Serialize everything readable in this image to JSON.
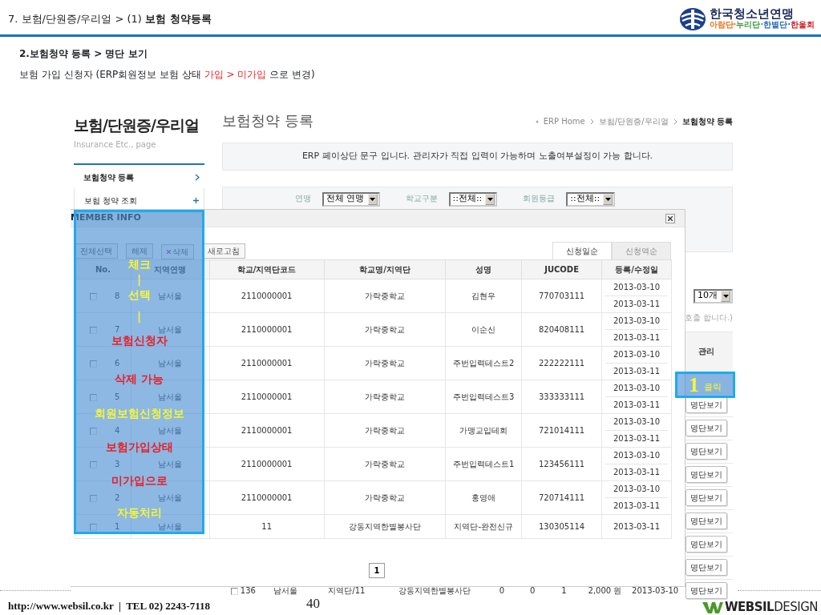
{
  "slide": {
    "title": "7. 보험/단원증/우리얼 > (1) ",
    "title_bold": "보험 청약등록",
    "logo": {
      "name": "한국청소년연맹",
      "parts": [
        {
          "text": "아람단·",
          "color": "#e8731c"
        },
        {
          "text": "누리단·",
          "color": "#3a9a3a"
        },
        {
          "text": "한별단·",
          "color": "#2a6fb8"
        },
        {
          "text": "한울회",
          "color": "#d0202a"
        }
      ]
    },
    "heading": "2.보험청약 등록 > 명단 보기",
    "description": [
      {
        "text": "보험 가입 신청자 (ERP회원정보 보험 상태 ",
        "highlight": false
      },
      {
        "text": "가입 > 미가입",
        "highlight": true
      },
      {
        "text": " 으로 변경)",
        "highlight": false
      }
    ]
  },
  "page": {
    "section_title": "보험/단원증/우리얼",
    "section_subtitle": "Insurance Etc., page",
    "menu": [
      {
        "label": "보험청약 등록",
        "selected": true,
        "kind": "link"
      },
      {
        "label": "보험 청약 조회",
        "selected": false,
        "kind": "expand"
      }
    ],
    "title": "보험청약 등록",
    "breadcrumb": [
      "ERP Home",
      "보험/단원증/우리얼",
      "보험청약 등록"
    ],
    "notice": "ERP 페이상단 문구 입니다. 관리자가 직접 입력이 가능하며 노출여부설정이 가능 합니다.",
    "filters": [
      {
        "label": "연맹",
        "value": "전체 연맹"
      },
      {
        "label": "학교구분",
        "value": "::전체::"
      },
      {
        "label": "회원등급",
        "value": "::전체::"
      }
    ],
    "page_size": "10개",
    "note": "호출 합니다.)",
    "action_header": "관리",
    "actions": [
      "명단보기",
      "명단보기",
      "명단보기",
      "명단보기",
      "명단보기",
      "명단보기",
      "명단보기",
      "명단보기"
    ],
    "last_row": {
      "checked": false,
      "cells": [
        "136",
        "남서울",
        "지역단/11",
        "강동지역한별봉사단",
        "0",
        "0",
        "1",
        "2,000 원",
        "2013-03-10"
      ],
      "action": "명단보기"
    }
  },
  "modal": {
    "title": "MEMBER INFO",
    "toolbar": [
      {
        "label": "전체선택",
        "kind": "plain"
      },
      {
        "label": "해제",
        "kind": "plain"
      },
      {
        "label": "삭제",
        "kind": "delete"
      },
      {
        "label": "새로고침",
        "kind": "plain"
      }
    ],
    "sort_tabs": [
      {
        "label": "신청일순",
        "selected": true
      },
      {
        "label": "신청역순",
        "selected": false
      }
    ],
    "columns": [
      "No.",
      "지역연맹",
      "학교/지역단코드",
      "학교명/지역단",
      "성명",
      "JUCODE",
      "등록/수정일"
    ],
    "rows": [
      {
        "checked": false,
        "no": "8",
        "region": "남서울",
        "code": "2110000001",
        "school": "가락중학교",
        "name": "김현우",
        "jucode": "770703111",
        "dates": [
          "2013-03-10",
          "2013-03-11"
        ]
      },
      {
        "checked": false,
        "no": "7",
        "region": "남서울",
        "code": "2110000001",
        "school": "가락중학교",
        "name": "이순신",
        "jucode": "820408111",
        "dates": [
          "2013-03-10",
          "2013-03-11"
        ]
      },
      {
        "checked": false,
        "no": "6",
        "region": "남서울",
        "code": "2110000001",
        "school": "가락중학교",
        "name": "주번입력테스트2",
        "jucode": "222222111",
        "dates": [
          "2013-03-10",
          "2013-03-11"
        ]
      },
      {
        "checked": false,
        "no": "5",
        "region": "남서울",
        "code": "2110000001",
        "school": "가락중학교",
        "name": "주번입력테스트3",
        "jucode": "333333111",
        "dates": [
          "2013-03-10",
          "2013-03-11"
        ]
      },
      {
        "checked": false,
        "no": "4",
        "region": "남서울",
        "code": "2110000001",
        "school": "가락중학교",
        "name": "가맹교입테회",
        "jucode": "721014111",
        "dates": [
          "2013-03-10",
          "2013-03-11"
        ]
      },
      {
        "checked": false,
        "no": "3",
        "region": "남서울",
        "code": "2110000001",
        "school": "가락중학교",
        "name": "주번입력테스트1",
        "jucode": "123456111",
        "dates": [
          "2013-03-10",
          "2013-03-11"
        ]
      },
      {
        "checked": false,
        "no": "2",
        "region": "남서울",
        "code": "2110000001",
        "school": "가락중학교",
        "name": "홍영애",
        "jucode": "720714111",
        "dates": [
          "2013-03-10",
          "2013-03-11"
        ]
      },
      {
        "checked": false,
        "no": "1",
        "region": "남서울",
        "code": "11",
        "school": "강동지역한별봉사단",
        "name": "지역단-완전신규",
        "jucode": "130305114",
        "dates": [
          "2013-03-11"
        ]
      }
    ],
    "pages": [
      {
        "label": "1",
        "selected": true
      }
    ]
  },
  "annotations": [
    {
      "lines": [
        {
          "text": "체크",
          "kind": "yellow"
        },
        {
          "text": "|",
          "kind": "yellow"
        },
        {
          "text": "선택",
          "kind": "yellow"
        },
        {
          "text": "|",
          "kind": "yellow"
        },
        {
          "text": "보험신청자",
          "kind": "red"
        },
        {
          "text": "삭제 가능",
          "kind": "red"
        },
        {
          "text": "회원보험신청정보",
          "kind": "yellow"
        },
        {
          "text": "보험가입상태",
          "kind": "red"
        },
        {
          "text": "미가입으로",
          "kind": "red"
        },
        {
          "text": "자동처리",
          "kind": "yellow"
        }
      ]
    },
    {
      "step": "1",
      "label": "클릭"
    }
  ],
  "footer": {
    "contact": "http://www.websil.co.kr  |  TEL 02) 2243-7118",
    "page_number": "40",
    "brand": "**WEBSIL**DESIGN"
  }
}
